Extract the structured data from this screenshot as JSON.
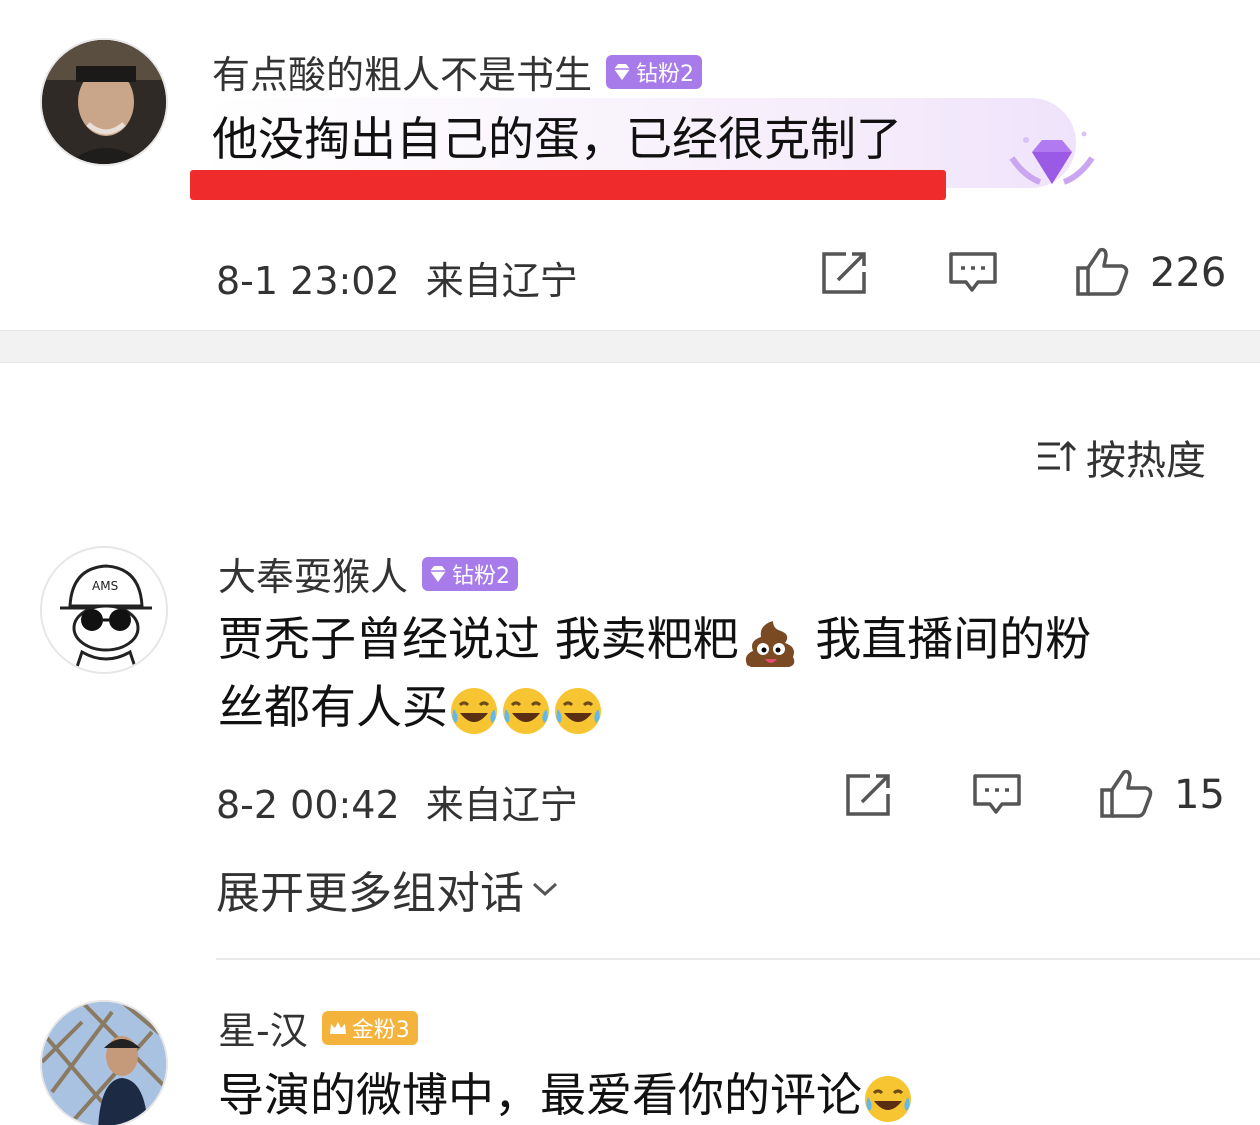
{
  "comments": [
    {
      "username": "有点酸的粗人不是书生",
      "badge": "钻粉2",
      "text": "他没掏出自己的蛋，已经很克制了",
      "time": "8-1 23:02",
      "location": "来自辽宁",
      "likes": "226"
    },
    {
      "username": "大奉耍猴人",
      "badge": "钻粉2",
      "text_line1_a": "贾秃子曾经说过 我卖粑粑",
      "text_line1_b": " 我直播间的粉",
      "text_line2": "丝都有人买",
      "time": "8-2 00:42",
      "location": "来自辽宁",
      "likes": "15"
    },
    {
      "username": "星-汉",
      "badge": "金粉3",
      "text": "导演的微博中，最爱看你的评论"
    }
  ],
  "sort": {
    "label": "按热度"
  },
  "expand": {
    "label": "展开更多组对话"
  },
  "icons": [
    "share-icon",
    "comment-icon",
    "like-icon",
    "sort-icon",
    "chevron-down-icon",
    "diamond-icon",
    "crown-icon",
    "poop-emoji",
    "laugh-cry-emoji"
  ],
  "colors": {
    "diamond_badge": "#a77bea",
    "gold_badge": "#f3b33d",
    "underline": "#f02b2b"
  }
}
